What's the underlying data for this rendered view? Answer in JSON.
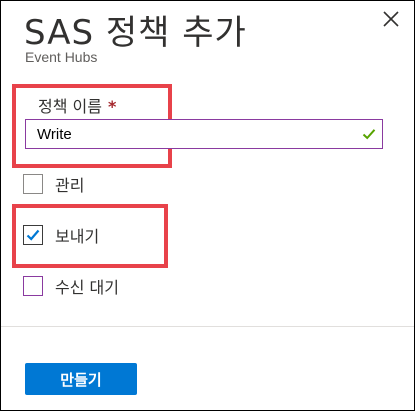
{
  "blade": {
    "title": "SAS 정책 추가",
    "subtitle": "Event Hubs"
  },
  "form": {
    "policy_name_label": "정책 이름",
    "required_marker": "*",
    "policy_name_value": "Write",
    "options": [
      {
        "label": "관리",
        "checked": false
      },
      {
        "label": "보내기",
        "checked": true
      },
      {
        "label": "수신 대기",
        "checked": false
      }
    ]
  },
  "footer": {
    "create_label": "만들기"
  },
  "icons": {
    "close": "close-icon",
    "valid": "checkmark-icon",
    "checkbox_check": "checkbox-checkmark-icon"
  },
  "colors": {
    "primary": "#0078d4",
    "highlight": "#e8424a",
    "focus_border": "#8a3aa0",
    "valid_check": "#57a300",
    "required": "#a4262c"
  }
}
